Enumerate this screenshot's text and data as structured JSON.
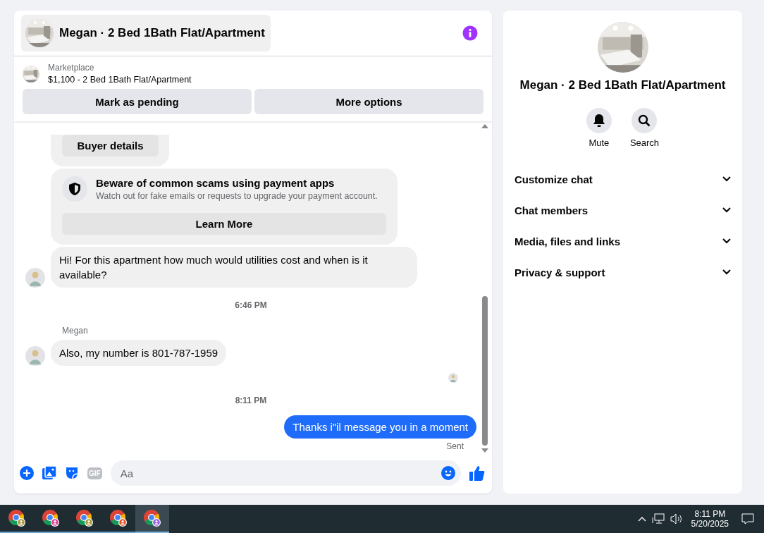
{
  "chat": {
    "title": "Megan · 2 Bed 1Bath Flat/Apartment",
    "marketplace": {
      "label": "Marketplace",
      "listing": "$1,100 - 2 Bed 1Bath Flat/Apartment"
    },
    "actions": [
      "Mark as pending",
      "More options"
    ],
    "messages": [
      {
        "kind": "card_button",
        "label": "Buyer details"
      },
      {
        "kind": "notice",
        "title": "Beware of common scams using payment apps",
        "body": "Watch out for fake emails or requests to upgrade your payment account.",
        "button": "Learn More"
      },
      {
        "kind": "incoming",
        "text": "Hi! For this apartment how much would utilities cost and when is it available?"
      },
      {
        "kind": "time",
        "text": "6:46 PM"
      },
      {
        "kind": "incoming",
        "sender": "Megan",
        "text": "Also, my number is 801-787-1959"
      },
      {
        "kind": "read_receipt"
      },
      {
        "kind": "time",
        "text": "8:11 PM"
      },
      {
        "kind": "outgoing",
        "text": "Thanks i\"il message you in a moment",
        "status": "Sent"
      }
    ],
    "composer": {
      "gif_label": "GIF",
      "placeholder": "Aa"
    }
  },
  "details": {
    "title": "Megan · 2 Bed 1Bath Flat/Apartment",
    "actions": [
      {
        "kind": "mute",
        "label": "Mute"
      },
      {
        "kind": "search",
        "label": "Search"
      }
    ],
    "sections": [
      {
        "label": "Customize chat",
        "expanded": false
      },
      {
        "label": "Chat members",
        "expanded": false
      },
      {
        "label": "Media, files and links",
        "expanded": false
      },
      {
        "label": "Privacy & support",
        "expanded": false
      }
    ]
  },
  "taskbar": {
    "apps": [
      {
        "color": "#a89a3c",
        "selected": false
      },
      {
        "color": "#e0409a",
        "selected": false
      },
      {
        "color": "#a89a3c",
        "selected": false
      },
      {
        "color": "#e8552a",
        "selected": false
      },
      {
        "color": "#9a5ae0",
        "selected": true
      }
    ],
    "time": "8:11 PM",
    "date": "5/20/2025"
  }
}
